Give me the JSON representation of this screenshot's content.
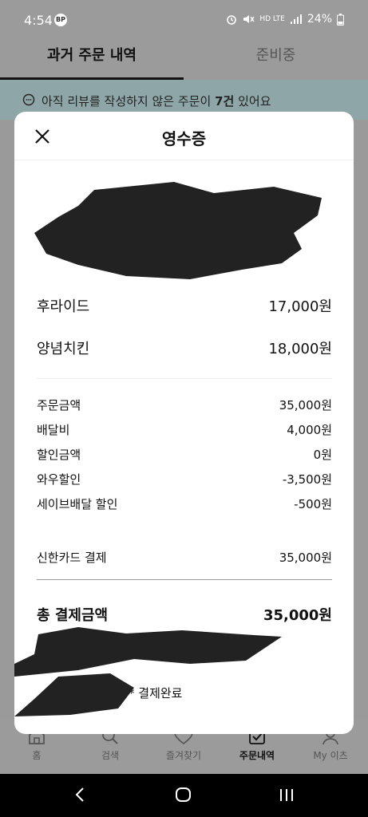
{
  "status_bar": {
    "time": "4:54",
    "app_badge": "BP",
    "network": "HD LTE",
    "battery": "24%"
  },
  "tabs": [
    {
      "label": "과거 주문 내역",
      "active": true
    },
    {
      "label": "준비중",
      "active": false
    }
  ],
  "banner": {
    "prefix": "아직 리뷰를 작성하지 않은 주문이",
    "count": "7건",
    "suffix": "있어요"
  },
  "receipt": {
    "title": "영수증",
    "items": [
      {
        "name": "후라이드",
        "price": "17,000원"
      },
      {
        "name": "양념치킨",
        "price": "18,000원"
      }
    ],
    "fees": [
      {
        "label": "주문금액",
        "value": "35,000원"
      },
      {
        "label": "배달비",
        "value": "4,000원"
      },
      {
        "label": "할인금액",
        "value": "0원"
      },
      {
        "label": "와우할인",
        "value": "-3,500원"
      },
      {
        "label": "세이브배달 할인",
        "value": "-500원"
      }
    ],
    "payment": {
      "label": "신한카드 결제",
      "value": "35,000원"
    },
    "total": {
      "label": "총 결제금액",
      "value": "35,000원"
    },
    "status": "* 결제완료"
  },
  "bottom_nav": [
    {
      "label": "홈",
      "icon": "home-icon",
      "active": false
    },
    {
      "label": "검색",
      "icon": "search-icon",
      "active": false
    },
    {
      "label": "즐겨찾기",
      "icon": "heart-icon",
      "active": false
    },
    {
      "label": "주문내역",
      "icon": "order-list-icon",
      "active": true
    },
    {
      "label": "My 이츠",
      "icon": "person-icon",
      "active": false
    }
  ],
  "colors": {
    "overlay": "#9a9a9a",
    "banner": "#8fa6a8",
    "modal": "#ffffff",
    "redaction": "#222222"
  }
}
